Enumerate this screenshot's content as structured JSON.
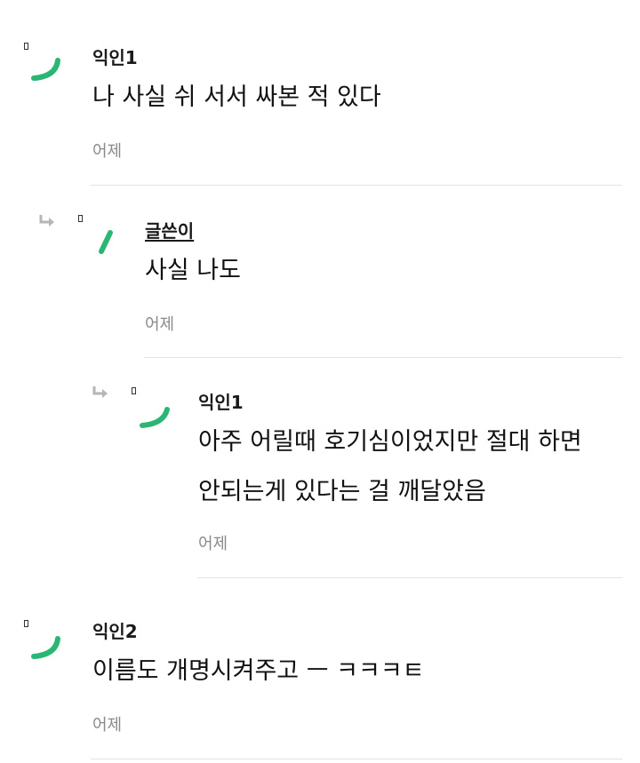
{
  "comments": [
    {
      "author": "익인1",
      "text_lines": [
        "나 사실 쉬 서서 싸본 적 있다"
      ],
      "time": "어제"
    },
    {
      "author": "글쓴이",
      "text_lines": [
        "사실 나도"
      ],
      "time": "어제"
    },
    {
      "author": "익인1",
      "text_lines": [
        "아주 어릴때 호기심이었지만 절대 하면",
        "안되는게 있다는 걸 깨달았음"
      ],
      "time": "어제"
    },
    {
      "author": "익인2",
      "text_lines": [
        "이름도 개명시켜주고 ㅡ ㅋㅋㅋㅌ"
      ],
      "time": "어제"
    }
  ],
  "colors": {
    "avatar_mark": "#2bb673",
    "reply_arrow": "#b5b5b5",
    "time_text": "#8a8a8a",
    "divider": "#e3e3e3"
  },
  "icons": {
    "reply": "reply-arrow-icon",
    "avatar": "anonymous-avatar-icon"
  }
}
